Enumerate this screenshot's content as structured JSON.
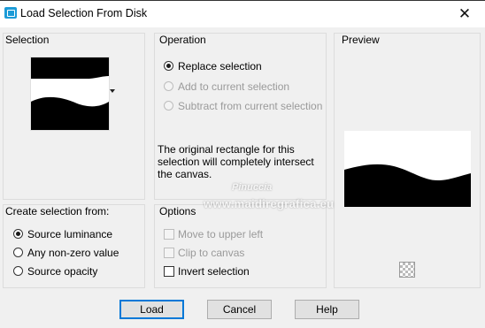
{
  "window": {
    "title": "Load Selection From Disk",
    "close_glyph": "✕"
  },
  "selection": {
    "label": "Selection"
  },
  "operation": {
    "label": "Operation",
    "options": [
      {
        "label": "Replace selection",
        "checked": true,
        "enabled": true
      },
      {
        "label": "Add to current selection",
        "checked": false,
        "enabled": false
      },
      {
        "label": "Subtract from current selection",
        "checked": false,
        "enabled": false
      }
    ],
    "note": "The original rectangle for this selection will completely intersect the canvas."
  },
  "preview": {
    "label": "Preview"
  },
  "create_from": {
    "label": "Create selection from:",
    "options": [
      {
        "label": "Source luminance",
        "checked": true
      },
      {
        "label": "Any non-zero value",
        "checked": false
      },
      {
        "label": "Source opacity",
        "checked": false
      }
    ]
  },
  "options": {
    "label": "Options",
    "items": [
      {
        "label": "Move to upper left",
        "checked": false,
        "enabled": false
      },
      {
        "label": "Clip to canvas",
        "checked": false,
        "enabled": false
      },
      {
        "label": "Invert selection",
        "checked": false,
        "enabled": true
      }
    ]
  },
  "watermark": {
    "line1": "Pinuccia",
    "line2": "www.maidiregrafica.eu"
  },
  "buttons": {
    "load": "Load",
    "cancel": "Cancel",
    "help": "Help"
  }
}
